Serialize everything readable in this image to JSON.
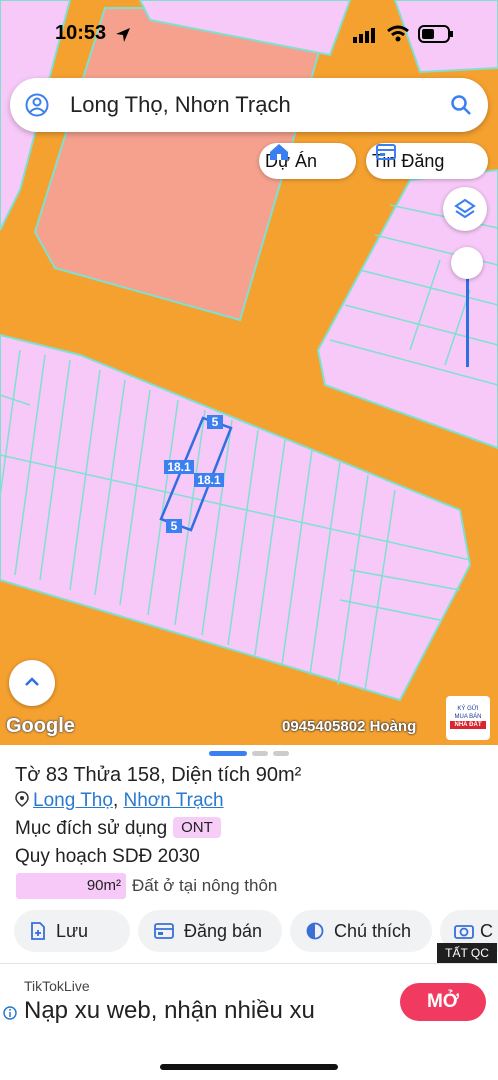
{
  "status_bar": {
    "time": "10:53"
  },
  "search": {
    "text": "Long Thọ, Nhơn Trạch"
  },
  "chips": {
    "du_an": "Dự Án",
    "tin_dang": "Tin Đăng"
  },
  "map": {
    "measurements": {
      "top": "5",
      "bottom": "5",
      "left": "18.1",
      "right": "18.1"
    },
    "google_label": "Google",
    "phone_overlay": "0945405802 Hoàng",
    "ad_logo_lines": [
      "KÝ GỬI",
      "MUA BÁN",
      "NHÀ ĐẤT"
    ]
  },
  "parcel": {
    "title": "Tờ 83 Thửa 158, Diện tích 90m²",
    "location_part1": "Long Thọ",
    "location_sep": ", ",
    "location_part2": "Nhơn Trạch",
    "purpose_label": "Mục đích sử dụng",
    "purpose_code": "ONT",
    "plan_label": "Quy hoạch SDĐ 2030",
    "plan_area": "90m²",
    "plan_desc": "Đất ở tại nông thôn",
    "plan_fraction": 1.0
  },
  "actions": {
    "save": "Lưu",
    "sell": "Đăng bán",
    "legend": "Chú thích",
    "camera": "C"
  },
  "ad": {
    "tag": "TẤT QC",
    "source": "TikTokLive",
    "title": "Nạp xu web, nhận nhiều xu",
    "cta": "MỞ"
  },
  "colors": {
    "orange": "#F5A130",
    "pink": "#F7C9F8",
    "salmon": "#F5A18E",
    "accent": "#2979d0"
  }
}
